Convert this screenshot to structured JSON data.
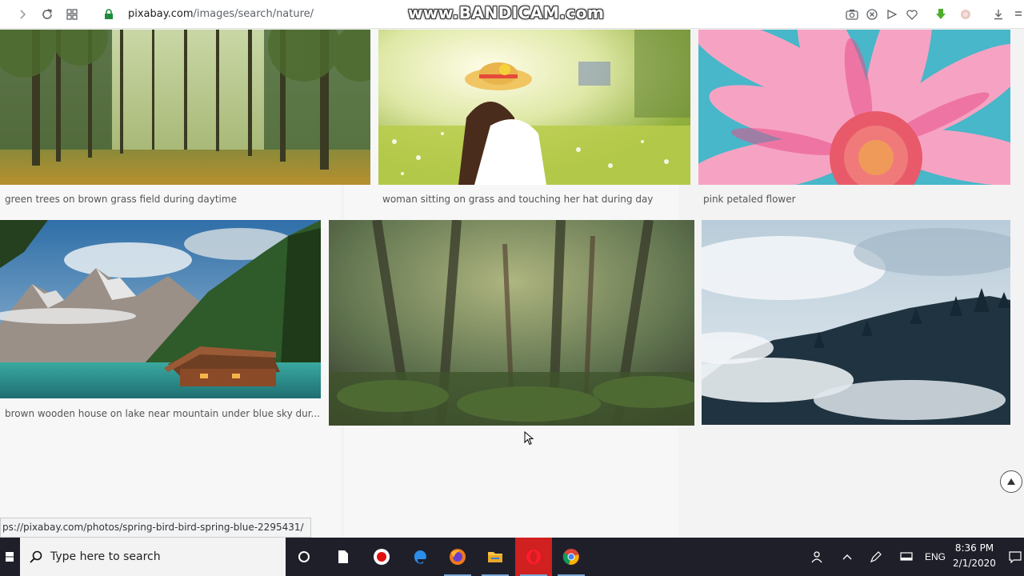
{
  "browser": {
    "url_host": "pixabay.com",
    "url_path": "/images/search/nature/",
    "watermark": "www.BANDICAM.com",
    "icons": [
      "forward-icon",
      "reload-icon",
      "apps-icon",
      "lock-icon",
      "camera-icon",
      "close-circle-icon",
      "send-icon",
      "heart-icon",
      "download-green-icon",
      "extension-icon",
      "download-icon",
      "menu-icon"
    ]
  },
  "gallery": {
    "row1": [
      {
        "caption": "green trees on brown grass field during daytime"
      },
      {
        "caption": "woman sitting on grass and touching her hat during day"
      },
      {
        "caption": "pink petaled flower"
      }
    ],
    "row2": [
      {
        "caption": "brown wooden house on lake near mountain under blue sky dur..."
      },
      {
        "caption": ""
      },
      {
        "caption": ""
      }
    ]
  },
  "status_url": "ps://pixabay.com/photos/spring-bird-bird-spring-blue-2295431/",
  "taskbar": {
    "search_placeholder": "Type here to search",
    "apps": [
      "cortana-icon",
      "file-icon",
      "record-icon",
      "edge-icon",
      "firefox-icon",
      "explorer-icon",
      "opera-icon",
      "chrome-icon"
    ],
    "language": "ENG",
    "time": "8:36 PM",
    "date": "2/1/2020"
  }
}
